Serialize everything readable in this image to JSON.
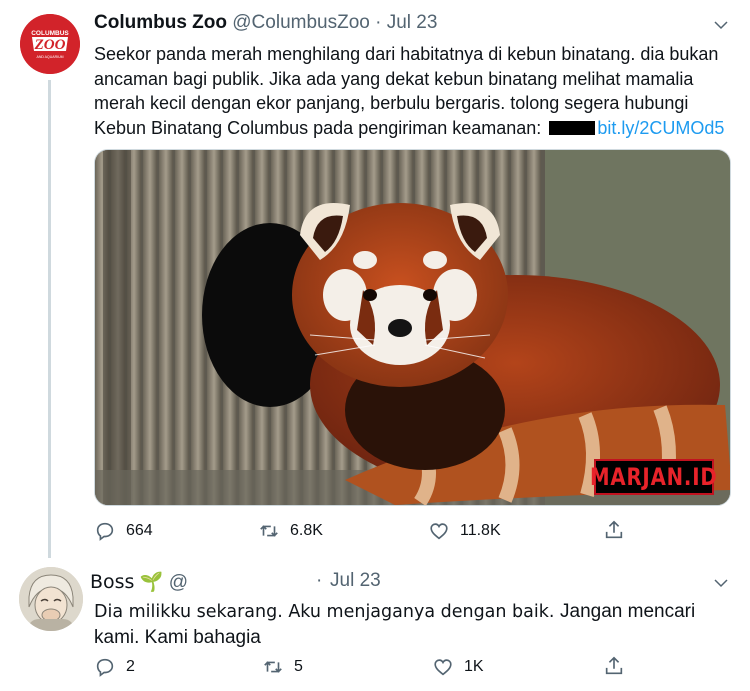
{
  "tweet1": {
    "author_name": "Columbus Zoo",
    "handle": "@ColumbusZoo",
    "separator": "·",
    "date": "Jul 23",
    "avatar_logo_top": "COLUMBUS",
    "avatar_logo_main": "ZOO",
    "avatar_logo_bottom": "AND AQUARIUM",
    "text": "Seekor panda merah menghilang dari habitatnya di kebun binatang. dia bukan ancaman bagi publik. Jika ada yang dekat kebun binatang melihat mamalia merah kecil dengan ekor panjang, berbulu bergaris. tolong segera hubungi Kebun Binatang Columbus pada pengiriman keamanan:",
    "link": "bit.ly/2CUMOd5",
    "watermark": "MARJAN.ID",
    "replies": "664",
    "retweets": "6.8K",
    "likes": "11.8K",
    "icons": [
      "reply-icon",
      "retweet-icon",
      "like-icon",
      "share-icon",
      "chevron-down-icon"
    ]
  },
  "tweet2": {
    "author_name": "Boss",
    "name_emoji": "🌱",
    "handle": "@",
    "separator": "·",
    "date": "Jul 23",
    "text_part1": "Dia milikku sekarang. Aku menjaganya dengan baik. ",
    "text_part2": "Jangan mencari kami. Kami bahagia",
    "replies": "2",
    "retweets": "5",
    "likes": "1K"
  },
  "colors": {
    "text": "#0f1419",
    "muted": "#536471",
    "link": "#1d9bf0",
    "zoo_red": "#d2232a",
    "thread_line": "#cfd9de"
  }
}
